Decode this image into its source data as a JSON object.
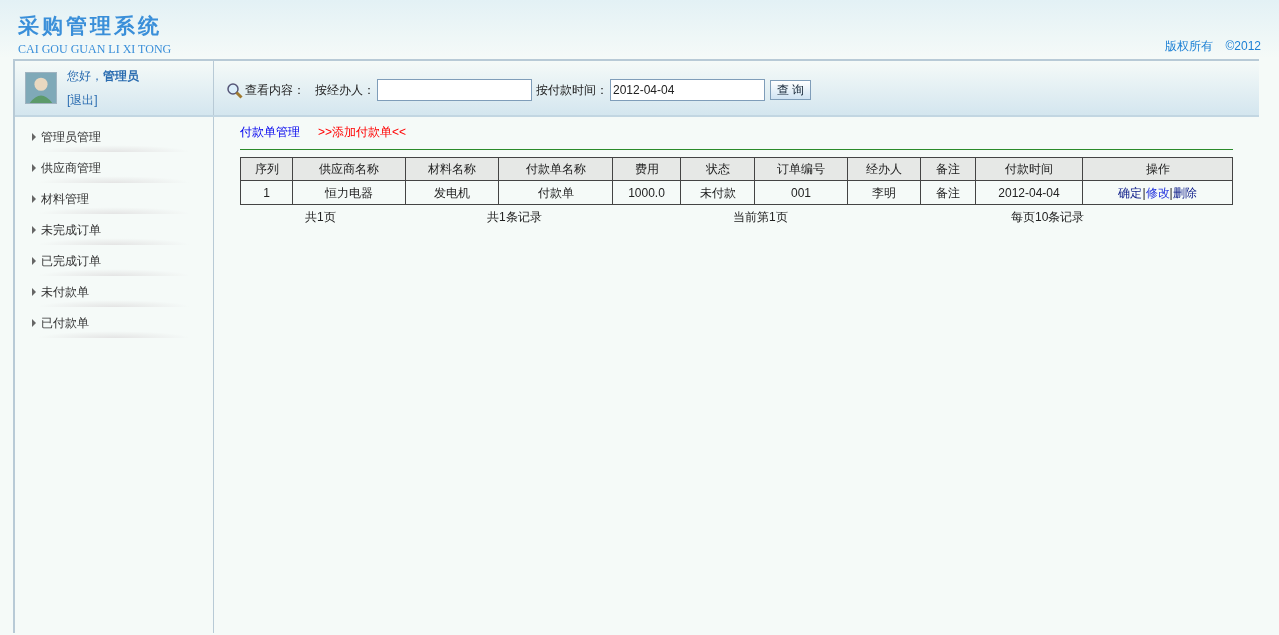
{
  "header": {
    "title": "采购管理系统",
    "subtitle": "CAI GOU GUAN LI XI TONG",
    "copyright": "版权所有",
    "year": "©2012"
  },
  "user": {
    "greeting": "您好，",
    "name": "管理员",
    "logout": "[退出]"
  },
  "search": {
    "label": "查看内容：",
    "agent_label": "按经办人：",
    "date_label": "按付款时间：",
    "date_value": "2012-04-04",
    "button": "查 询"
  },
  "sidebar": {
    "items": [
      {
        "label": "管理员管理"
      },
      {
        "label": "供应商管理"
      },
      {
        "label": "材料管理"
      },
      {
        "label": "未完成订单"
      },
      {
        "label": "已完成订单"
      },
      {
        "label": "未付款单"
      },
      {
        "label": "已付款单"
      }
    ]
  },
  "content": {
    "title": "付款单管理",
    "add_link": ">>添加付款单<<"
  },
  "table": {
    "columns": [
      "序列",
      "供应商名称",
      "材料名称",
      "付款单名称",
      "费用",
      "状态",
      "订单编号",
      "经办人",
      "备注",
      "付款时间",
      "操作"
    ],
    "rows": [
      {
        "cells": [
          "1",
          "恒力电器",
          "发电机",
          "付款单",
          "1000.0",
          "未付款",
          "001",
          "李明",
          "备注",
          "2012-04-04"
        ],
        "actions": [
          {
            "label": "确定",
            "sep": "|"
          },
          {
            "label": "修改",
            "sep": "|"
          },
          {
            "label": "删除"
          }
        ]
      }
    ]
  },
  "pagination": [
    "共1页",
    "共1条记录",
    "当前第1页",
    "每页10条记录"
  ]
}
